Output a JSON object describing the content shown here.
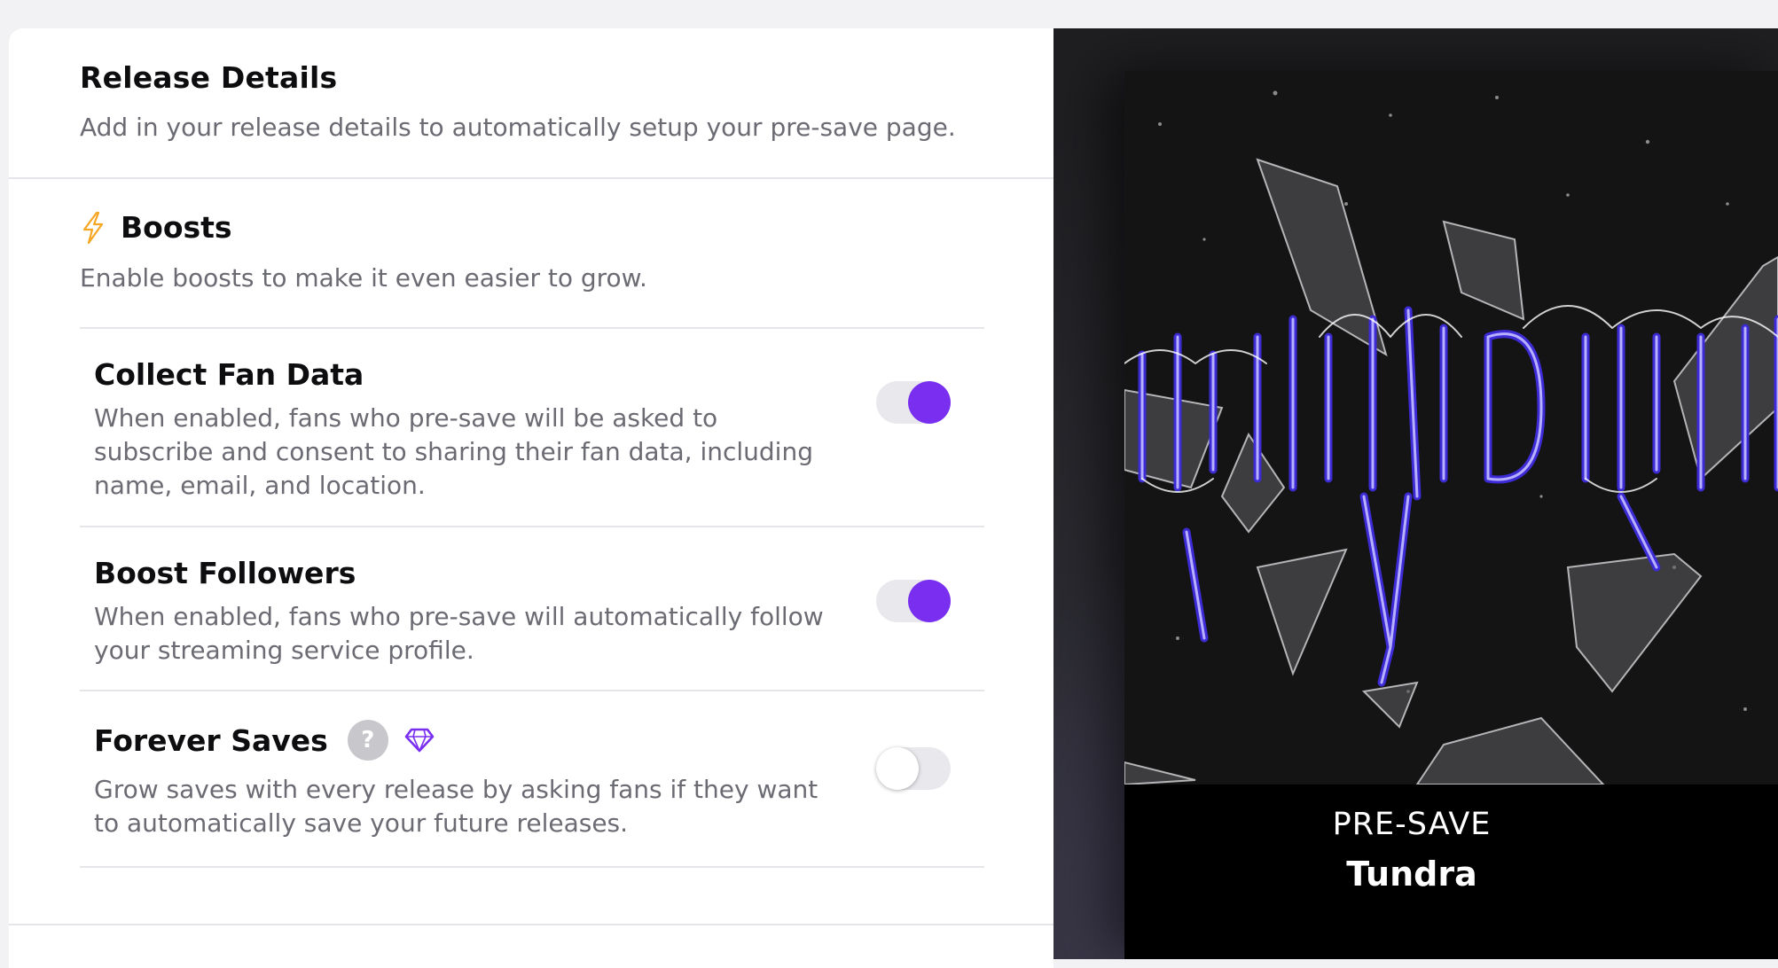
{
  "release": {
    "title": "Release Details",
    "subtitle": "Add in your release details to automatically setup your pre-save page."
  },
  "boosts": {
    "icon": "lightning-bolt-icon",
    "title": "Boosts",
    "subtitle": "Enable boosts to make it even easier to grow.",
    "options": [
      {
        "title": "Collect Fan Data",
        "description": "When enabled, fans who pre-save will be asked to subscribe and consent to sharing their fan data, including name, email, and location.",
        "enabled": true
      },
      {
        "title": "Boost Followers",
        "description": "When enabled, fans who pre-save will automatically follow your streaming service profile.",
        "enabled": true
      },
      {
        "title": "Forever Saves",
        "help_icon_text": "?",
        "badge_icon": "diamond-icon",
        "description": "Grow saves with every release by asking fans if they want to automatically save your future releases.",
        "enabled": false
      }
    ]
  },
  "preview": {
    "label": "PRE-SAVE",
    "title": "Tundra"
  },
  "colors": {
    "accent": "#7a2ff0",
    "bolt": "#f5a623",
    "text_primary": "#0d0d0f",
    "text_secondary": "#6b6b73",
    "divider": "#e6e6ea"
  }
}
